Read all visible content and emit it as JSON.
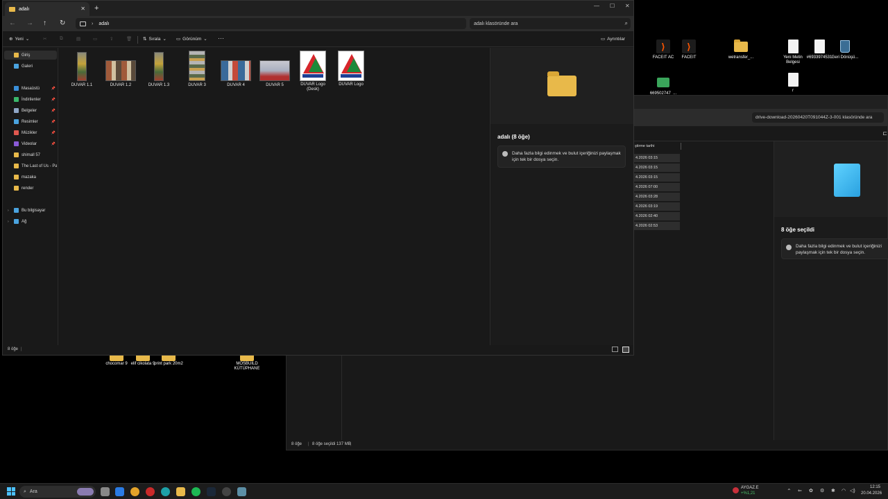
{
  "desktop": {
    "icons_right": [
      {
        "label": "FACEIT AC",
        "type": "faceit"
      },
      {
        "label": "FACEIT",
        "type": "faceit"
      },
      {
        "label": "wetransfer_...",
        "type": "folder"
      },
      {
        "label": "Yeni Metin Belgesi",
        "type": "doc"
      },
      {
        "label": "#6933974531",
        "type": "doc"
      },
      {
        "label": "Geri Dönüşü...",
        "type": "bin"
      },
      {
        "label": "669502747_...",
        "type": "green"
      },
      {
        "label": "r",
        "type": "doc"
      }
    ],
    "icons_bottom": [
      {
        "label": "chocomar 9"
      },
      {
        "label": "elif cikolata 9"
      },
      {
        "label": "print park 20m2"
      },
      {
        "label": "MOSBUILD KÜTÜPHANE"
      }
    ]
  },
  "back_window": {
    "search_placeholder": "drive-download-20260420T091044Z-3-001 klasöründe ara",
    "column_header": "ştirme tarihi",
    "dates": [
      "4.2026 03:15",
      "4.2026 03:15",
      "4.2026 03:15",
      "4.2026 07:00",
      "4.2026 03:28",
      "4.2026 03:19",
      "4.2026 02:40",
      "4.2026 02:53"
    ],
    "details_title": "8 öğe seçildi",
    "details_info": "Daha fazla bilgi edinmek ve bulut içeriğinizi paylaşmak için tek bir dosya seçin.",
    "status_count": "8 öğe",
    "status_selected": "8 öğe seçildi  137 MB"
  },
  "window": {
    "tab_title": "adalı",
    "new_tab": "+",
    "controls": {
      "minimize": "—",
      "maximize": "☐",
      "close": "✕"
    },
    "address_path": "adalı",
    "search_placeholder": "adalı klasöründe ara",
    "toolbar": {
      "new": "Yeni",
      "sort": "Sırala",
      "view": "Görünüm",
      "more": "···",
      "details": "Ayrıntılar"
    },
    "sidebar": {
      "top": [
        {
          "label": "Giriş",
          "color": "#e8b94a",
          "selected": true
        },
        {
          "label": "Galeri",
          "color": "#4aa3df"
        }
      ],
      "pinned": [
        {
          "label": "Masaüstü",
          "color": "#3a8fd9",
          "pin": true
        },
        {
          "label": "İndirilenler",
          "color": "#3ab86a",
          "pin": true
        },
        {
          "label": "Belgeler",
          "color": "#8fa6c6",
          "pin": true
        },
        {
          "label": "Resimler",
          "color": "#4aa3df",
          "pin": true
        },
        {
          "label": "Müzikler",
          "color": "#e0584f",
          "pin": true
        },
        {
          "label": "Videolar",
          "color": "#8a5ad6",
          "pin": true
        },
        {
          "label": "shimall 57",
          "color": "#e8b94a"
        },
        {
          "label": "The Last of Us - Pa",
          "color": "#e8b94a"
        },
        {
          "label": "mazaka",
          "color": "#e8b94a"
        },
        {
          "label": "render",
          "color": "#e8b94a"
        }
      ],
      "bottom": [
        {
          "label": "Bu bilgisayar",
          "color": "#4aa3df"
        },
        {
          "label": "Ağ",
          "color": "#4aa3df"
        }
      ]
    },
    "files": [
      {
        "name": "DUVAR 1.1",
        "kind": "tall"
      },
      {
        "name": "DUVAR 1.2",
        "kind": "wide"
      },
      {
        "name": "DUVAR 1.3",
        "kind": "tall"
      },
      {
        "name": "DUVAR 3",
        "kind": "tall2"
      },
      {
        "name": "DUVAR 4",
        "kind": "wide2"
      },
      {
        "name": "DUVAR 5",
        "kind": "wide3"
      },
      {
        "name": "DUVAR Logo (Desk)",
        "kind": "logo"
      },
      {
        "name": "DUVAR Logo",
        "kind": "logo"
      }
    ],
    "details_title": "adalı (8 öğe)",
    "details_info": "Daha fazla bilgi edinmek ve bulut içeriğinizi paylaşmak için tek bir dosya seçin.",
    "status": "8 öğe"
  },
  "taskbar": {
    "search": "Ara",
    "weather_title": "AYGAZ.E",
    "weather_value": "+%1,21",
    "time": "12:15",
    "date": "20.04.2026"
  }
}
